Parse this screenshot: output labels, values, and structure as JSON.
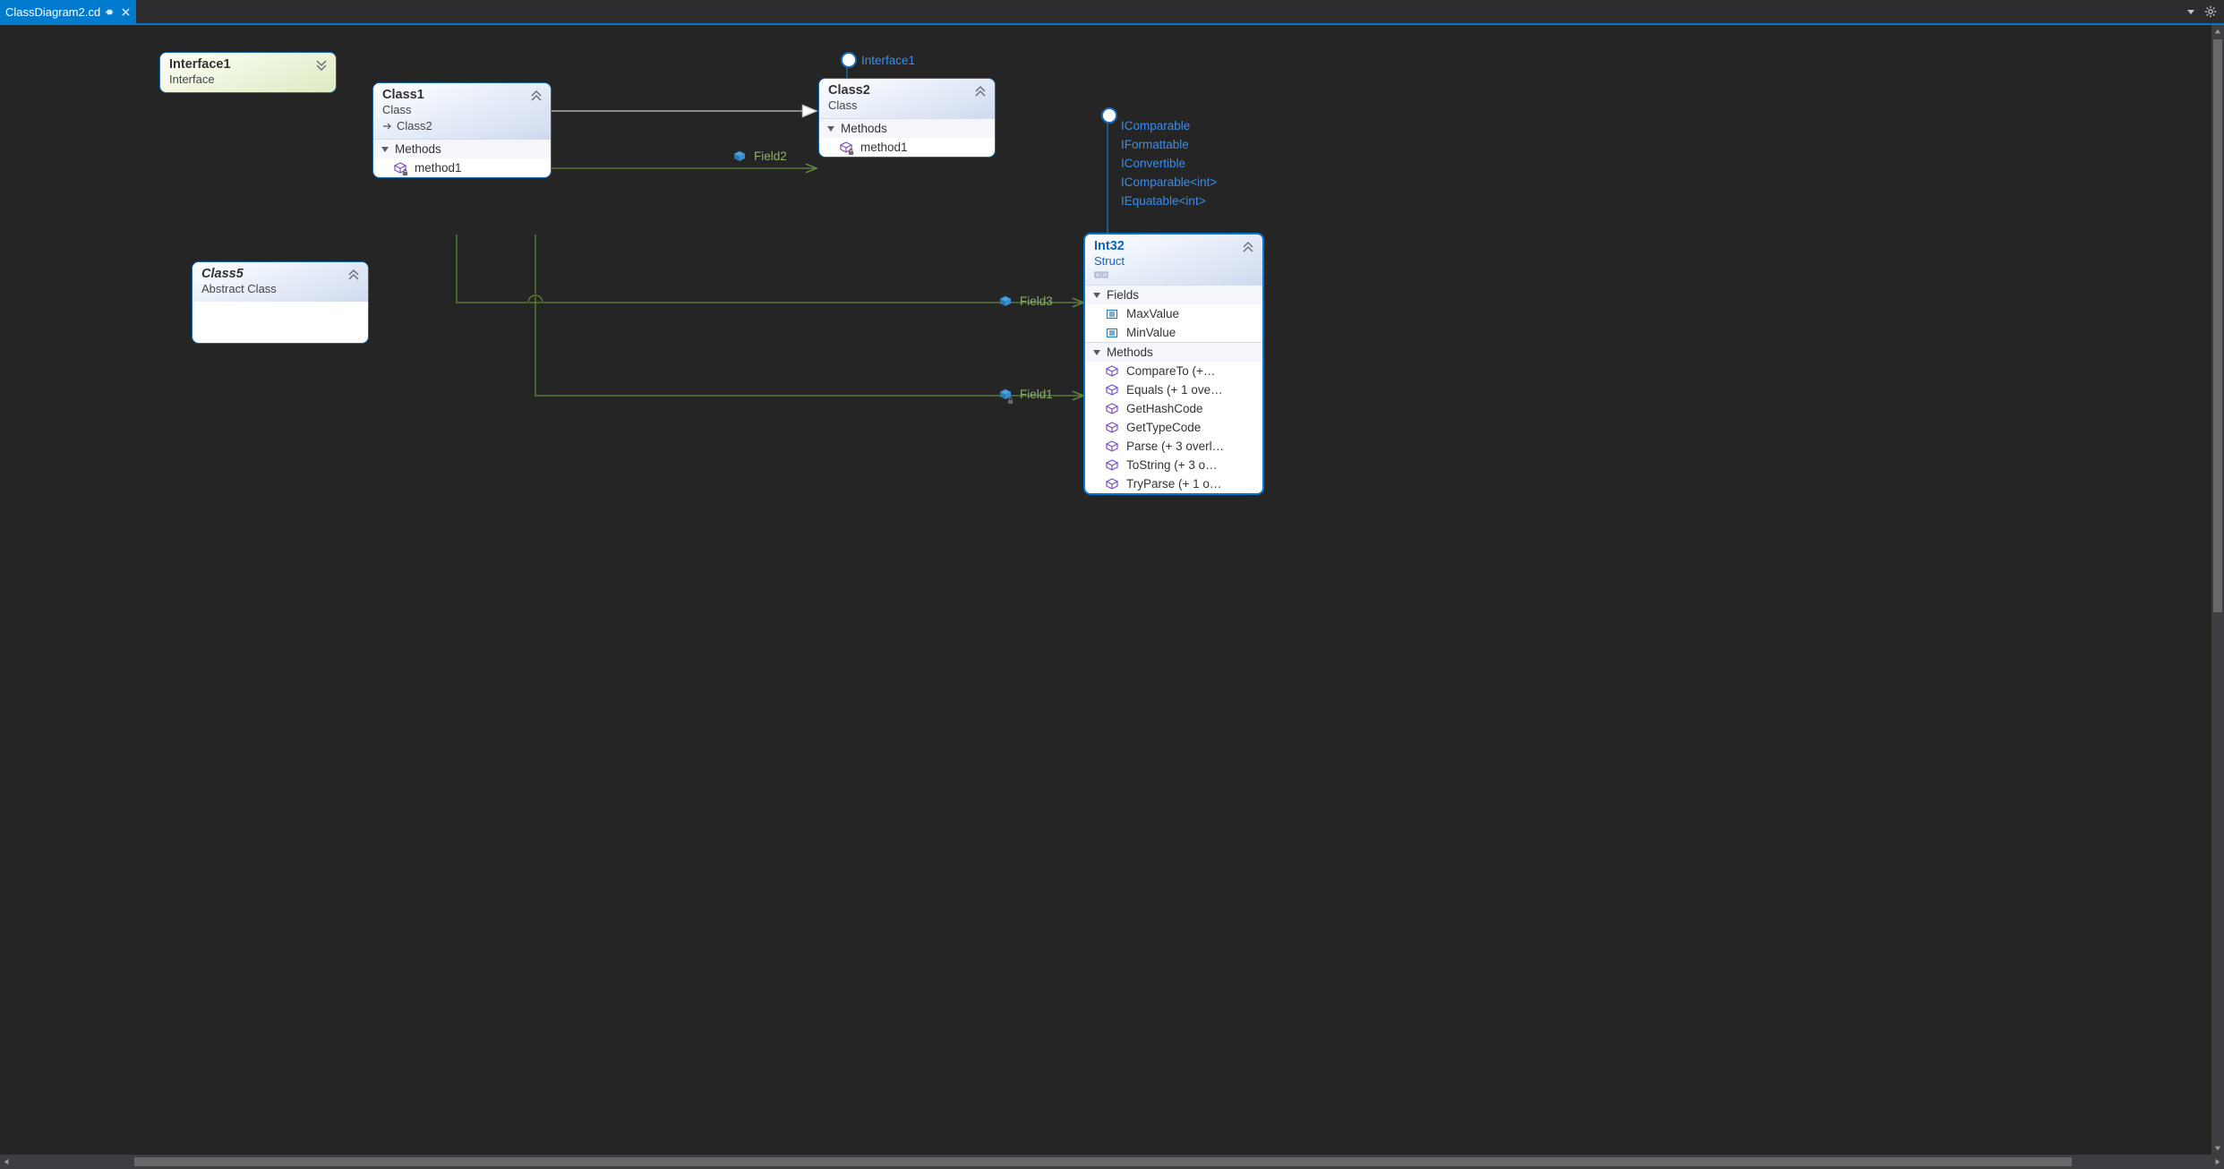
{
  "tabbar": {
    "tab_label": "ClassDiagram2.cd"
  },
  "nodes": {
    "interface1": {
      "title": "Interface1",
      "subtitle": "Interface"
    },
    "class1": {
      "title": "Class1",
      "subtitle": "Class",
      "subrow": "Class2",
      "section_methods": "Methods",
      "members": {
        "m0": "method1"
      }
    },
    "class2": {
      "title": "Class2",
      "subtitle": "Class",
      "iface_label": "Interface1",
      "section_methods": "Methods",
      "members": {
        "m0": "method1"
      }
    },
    "class5": {
      "title": "Class5",
      "subtitle": "Abstract Class"
    },
    "int32": {
      "title": "Int32",
      "subtitle": "Struct",
      "interfaces": {
        "i0": "IComparable",
        "i1": "IFormattable",
        "i2": "IConvertible",
        "i3": "IComparable<int>",
        "i4": "IEquatable<int>"
      },
      "section_fields": "Fields",
      "fields": {
        "f0": "MaxValue",
        "f1": "MinValue"
      },
      "section_methods": "Methods",
      "methods": {
        "m0": "CompareTo  (+…",
        "m1": "Equals (+ 1 ove…",
        "m2": "GetHashCode",
        "m3": "GetTypeCode",
        "m4": "Parse (+ 3 overl…",
        "m5": "ToString (+ 3 o…",
        "m6": "TryParse (+ 1 o…"
      }
    }
  },
  "edges": {
    "field2": "Field2",
    "field3": "Field3",
    "field1": "Field1"
  }
}
